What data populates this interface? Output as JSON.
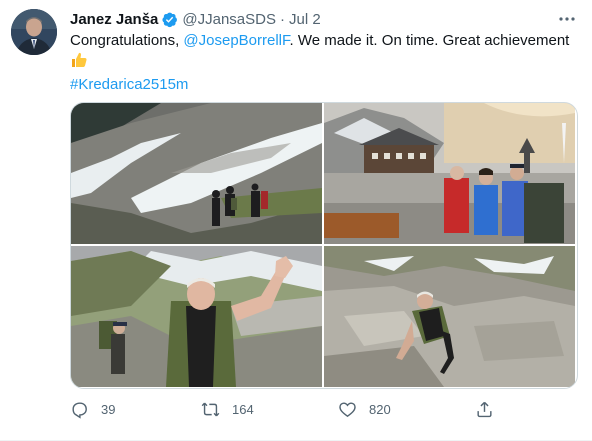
{
  "tweet": {
    "author_name": "Janez Janša",
    "handle": "@JJansaSDS",
    "separator": "·",
    "date": "Jul 2",
    "more_label": "···",
    "text_before": "Congratulations, ",
    "mention": "@JosepBorrellF",
    "text_after": ". We made it. On time. Great achievement",
    "emoji": "thumbs-up",
    "hashtag": "#Kredarica2515m",
    "verified_color": "#1d9bf0",
    "link_color": "#1d9bf0"
  },
  "media": {
    "photos": [
      {
        "subject": "hikers on rocky mountain slope with snow"
      },
      {
        "subject": "group of four in front of mountain hut"
      },
      {
        "subject": "man waving on mountain trail"
      },
      {
        "subject": "man climbing rocky terrain"
      }
    ]
  },
  "actions": {
    "reply_count": "39",
    "retweet_count": "164",
    "like_count": "820",
    "share_label": ""
  },
  "icons": [
    "verified-badge-icon",
    "more-icon",
    "reply-icon",
    "retweet-icon",
    "like-icon",
    "share-icon",
    "thumbs-up-icon"
  ]
}
